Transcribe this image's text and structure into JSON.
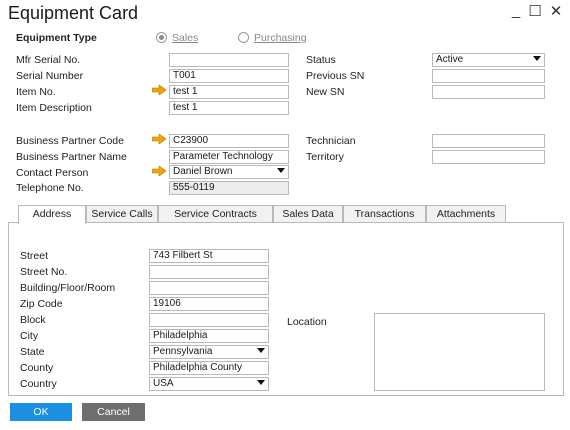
{
  "window": {
    "title": "Equipment Card",
    "minimize": "_",
    "maximize": "☐",
    "close": "✕"
  },
  "equipment_type": {
    "label": "Equipment Type",
    "options": [
      "Sales",
      "Purchasing"
    ],
    "selected": "Sales"
  },
  "left_fields": {
    "mfr_serial_label": "Mfr Serial No.",
    "mfr_serial_value": "",
    "serial_label": "Serial Number",
    "serial_value": "T001",
    "item_no_label": "Item No.",
    "item_no_value": "test 1",
    "item_desc_label": "Item Description",
    "item_desc_value": "test 1"
  },
  "right_fields": {
    "status_label": "Status",
    "status_value": "Active",
    "prev_sn_label": "Previous SN",
    "prev_sn_value": "",
    "new_sn_label": "New SN",
    "new_sn_value": ""
  },
  "partner": {
    "bp_code_label": "Business Partner Code",
    "bp_code_value": "C23900",
    "bp_name_label": "Business Partner Name",
    "bp_name_value": "Parameter Technology",
    "contact_label": "Contact Person",
    "contact_value": "Daniel Brown",
    "phone_label": "Telephone No.",
    "phone_value": "555-0119",
    "technician_label": "Technician",
    "technician_value": "",
    "territory_label": "Territory",
    "territory_value": ""
  },
  "tabs": [
    "Address",
    "Service Calls",
    "Service Contracts",
    "Sales Data",
    "Transactions",
    "Attachments"
  ],
  "active_tab": "Address",
  "address": {
    "street_label": "Street",
    "street_value": "743 Filbert St",
    "street_no_label": "Street No.",
    "street_no_value": "",
    "building_label": "Building/Floor/Room",
    "building_value": "",
    "zip_label": "Zip Code",
    "zip_value": "19106",
    "block_label": "Block",
    "block_value": "",
    "city_label": "City",
    "city_value": "Philadelphia",
    "state_label": "State",
    "state_value": "Pennsylvania",
    "county_label": "County",
    "county_value": "Philadelphia County",
    "country_label": "Country",
    "country_value": "USA",
    "location_label": "Location",
    "location_value": ""
  },
  "buttons": {
    "ok": "OK",
    "cancel": "Cancel"
  },
  "colors": {
    "ok_bg": "#1c8fe0",
    "cancel_bg": "#6e6e6e",
    "link_arrow": "#f0a500"
  }
}
